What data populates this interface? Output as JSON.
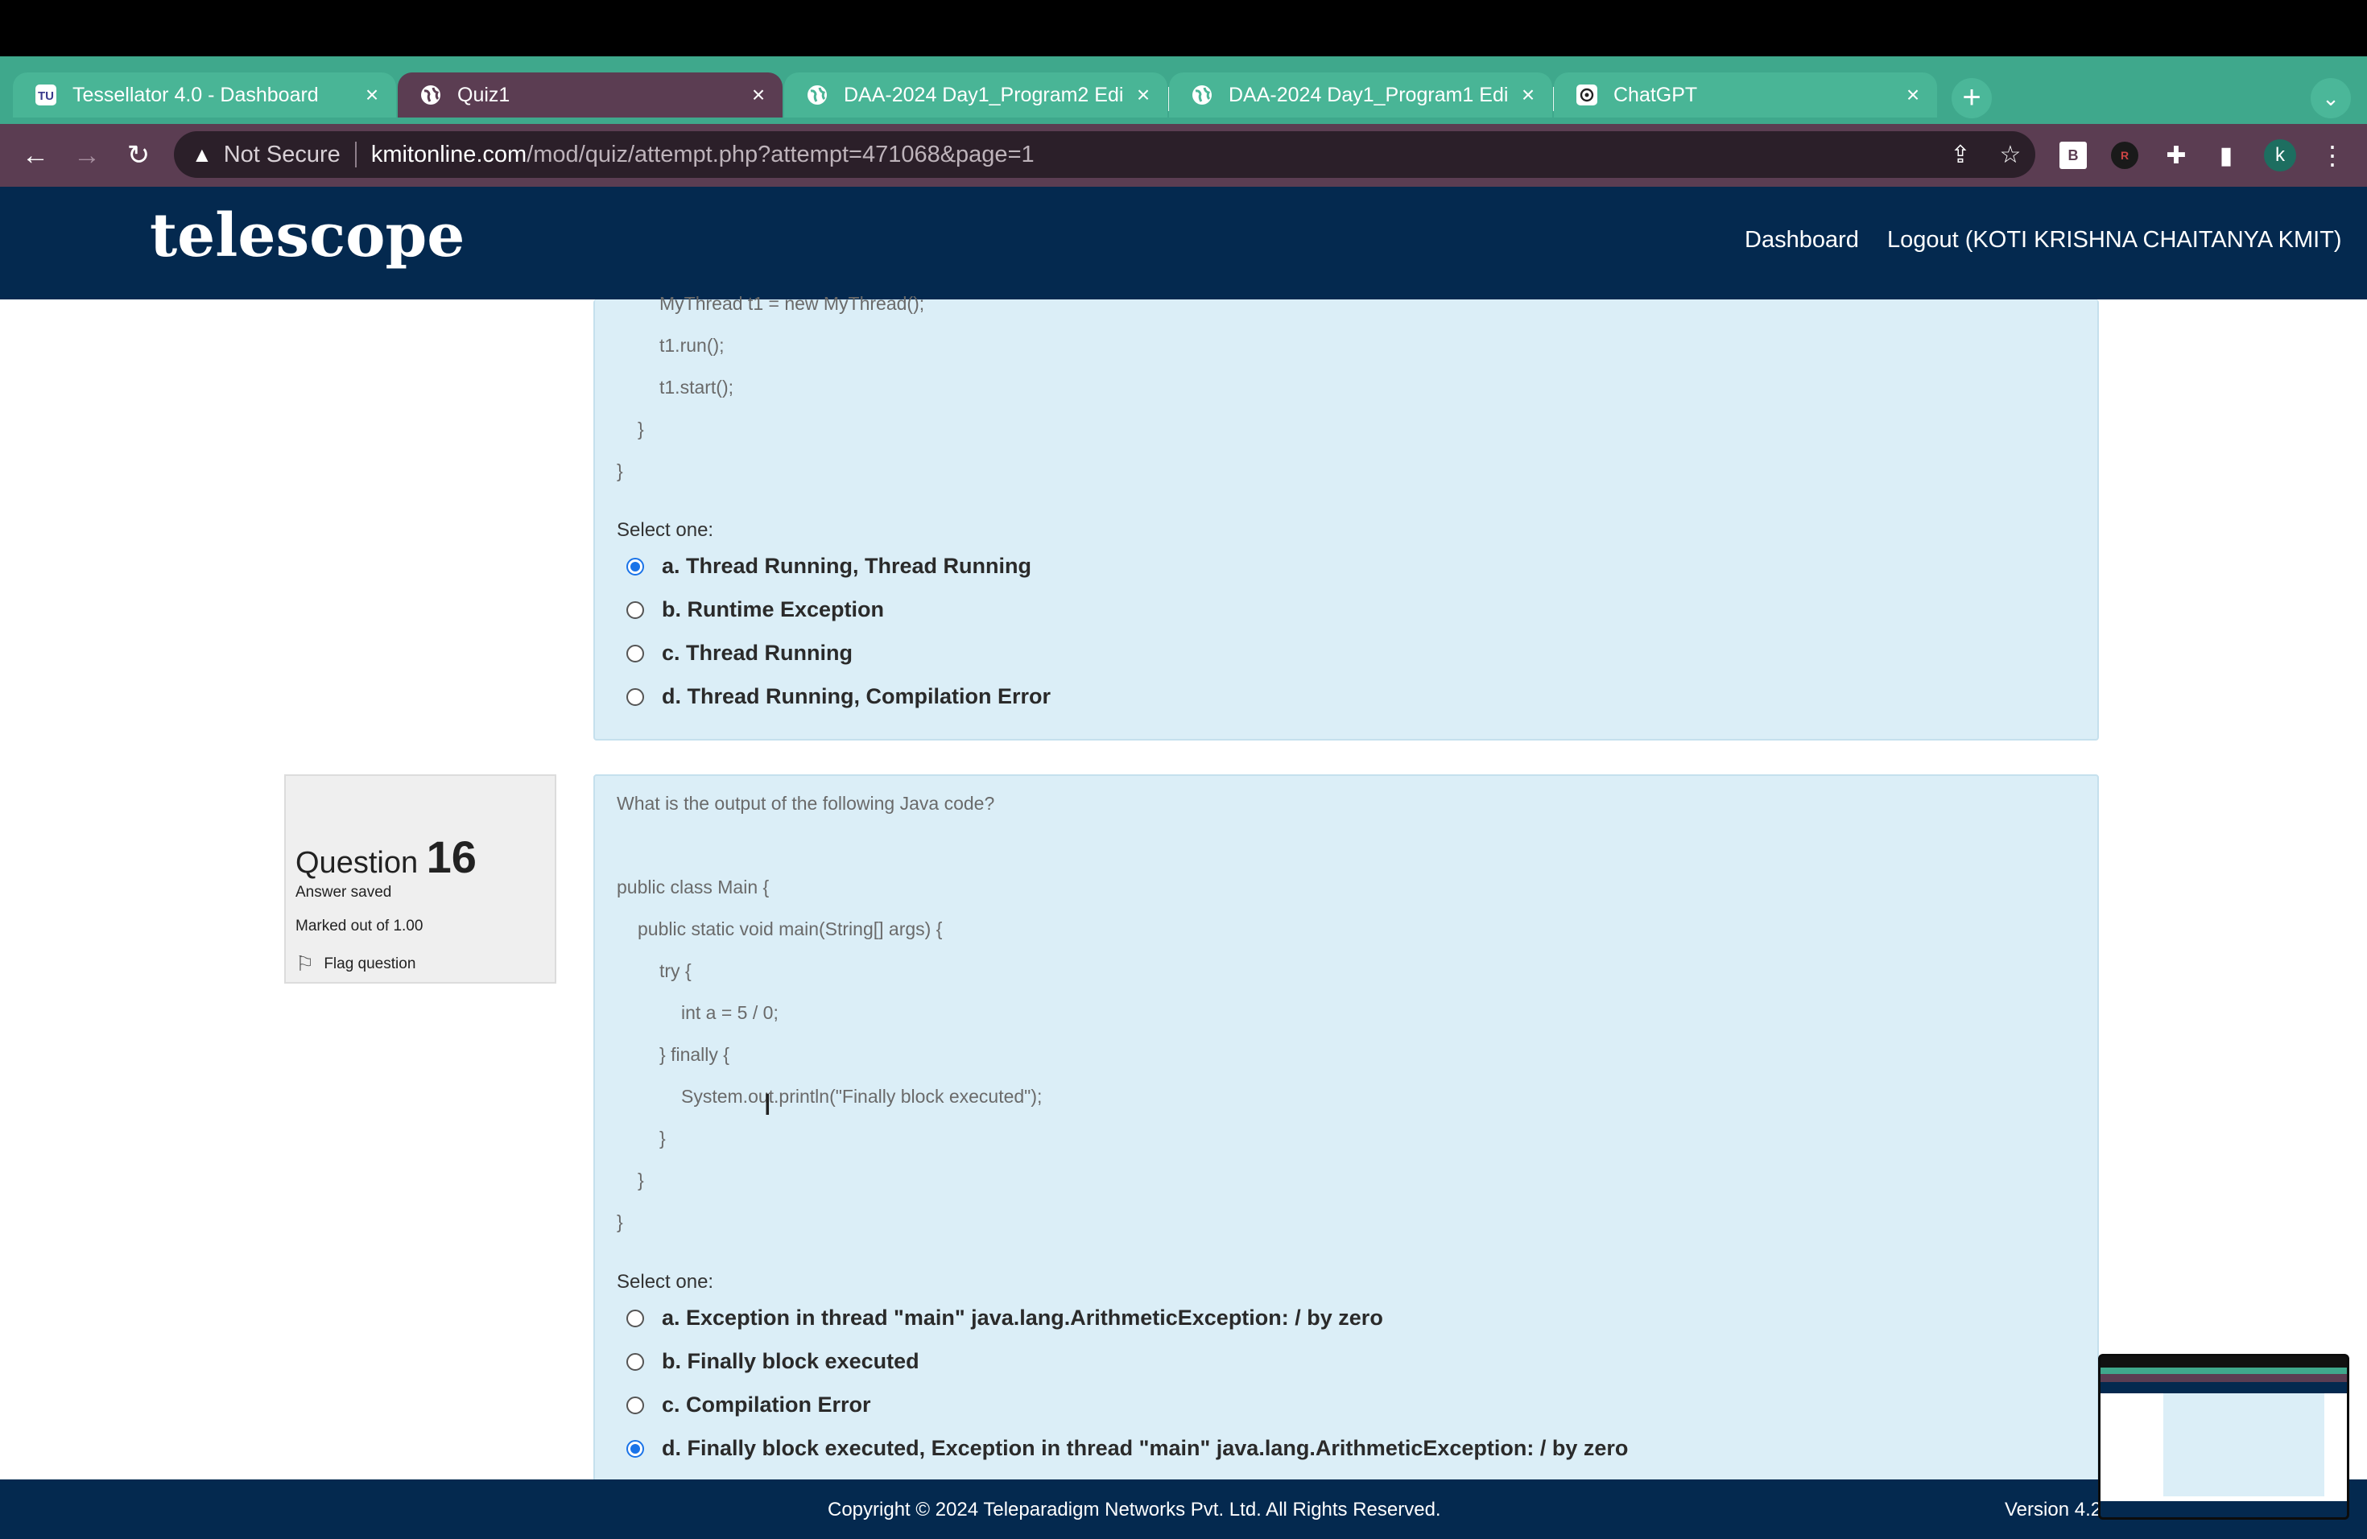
{
  "browser": {
    "tabs": [
      {
        "title": "Tessellator 4.0 - Dashboard",
        "icon": "tessellator-icon",
        "active": false
      },
      {
        "title": "Quiz1",
        "icon": "globe-icon",
        "active": true
      },
      {
        "title": "DAA-2024 Day1_Program2 Edi",
        "icon": "globe-icon",
        "active": false
      },
      {
        "title": "DAA-2024 Day1_Program1 Edi",
        "icon": "globe-icon",
        "active": false
      },
      {
        "title": "ChatGPT",
        "icon": "chatgpt-icon",
        "active": false
      }
    ],
    "security_label": "Not Secure",
    "url_host": "kmitonline.com",
    "url_path": "/mod/quiz/attempt.php?attempt=471068&page=1",
    "profile_initial": "k",
    "ext_b_label": "B",
    "ext_r_label": "R"
  },
  "site": {
    "logo": "telescope",
    "nav": {
      "dashboard": "Dashboard",
      "logout": "Logout (KOTI KRISHNA CHAITANYA KMIT)"
    }
  },
  "question15": {
    "code_lines": [
      "MyThread t1 = new MyThread();",
      "t1.run();",
      "t1.start();",
      "}",
      "}"
    ],
    "select_label": "Select one:",
    "options": [
      {
        "text": "a. Thread Running, Thread Running",
        "checked": true
      },
      {
        "text": "b. Runtime Exception",
        "checked": false
      },
      {
        "text": "c. Thread Running",
        "checked": false
      },
      {
        "text": "d. Thread Running, Compilation Error",
        "checked": false
      }
    ]
  },
  "question16": {
    "label": "Question",
    "number": "16",
    "status": "Answer saved",
    "marks": "Marked out of 1.00",
    "flag": "Flag question",
    "prompt": "What is the output of the following Java code?",
    "code_lines": [
      "public class Main {",
      "public static void main(String[] args) {",
      "try {",
      "int a = 5 / 0;",
      "} finally {",
      "System.out.println(\"Finally block executed\");",
      "}",
      "}",
      "}"
    ],
    "select_label": "Select one:",
    "options": [
      {
        "text": "a. Exception in thread \"main\" java.lang.ArithmeticException: / by zero",
        "checked": false
      },
      {
        "text": "b. Finally block executed",
        "checked": false
      },
      {
        "text": "c. Compilation Error",
        "checked": false
      },
      {
        "text": "d. Finally block executed, Exception in thread \"main\" java.lang.ArithmeticException: / by zero",
        "checked": true
      }
    ]
  },
  "footer": {
    "copyright": "Copyright © 2024 Teleparadigm Networks Pvt. Ltd. All Rights Reserved.",
    "version": "Version 4.2"
  }
}
